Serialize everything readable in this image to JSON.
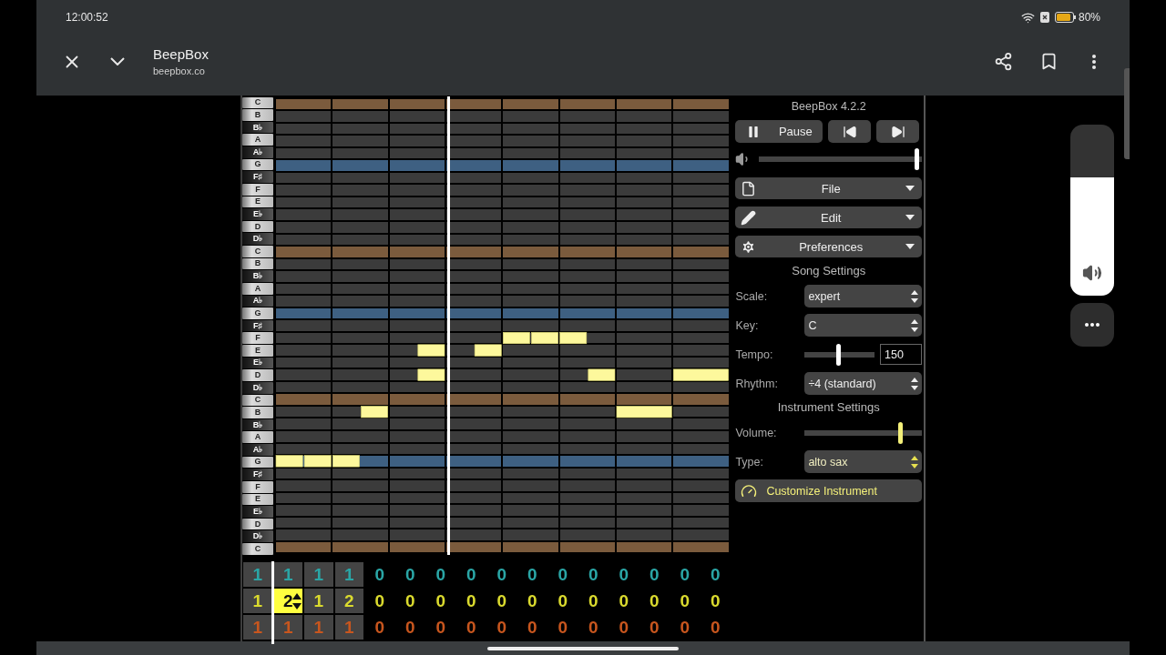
{
  "status_bar": {
    "time": "12:00:52",
    "battery": "80%"
  },
  "browser": {
    "title": "BeepBox",
    "url": "beepbox.co"
  },
  "piano_keys": [
    {
      "label": "C",
      "kind": "white",
      "color": "#7b5b3d"
    },
    {
      "label": "B",
      "kind": "white"
    },
    {
      "label": "B♭",
      "kind": "black"
    },
    {
      "label": "A",
      "kind": "white"
    },
    {
      "label": "A♭",
      "kind": "black"
    },
    {
      "label": "G",
      "kind": "white",
      "color": "#3e6082"
    },
    {
      "label": "F♯",
      "kind": "black"
    },
    {
      "label": "F",
      "kind": "white"
    },
    {
      "label": "E",
      "kind": "white"
    },
    {
      "label": "E♭",
      "kind": "black"
    },
    {
      "label": "D",
      "kind": "white"
    },
    {
      "label": "D♭",
      "kind": "black"
    },
    {
      "label": "C",
      "kind": "white",
      "color": "#7b5b3d"
    },
    {
      "label": "B",
      "kind": "white"
    },
    {
      "label": "B♭",
      "kind": "black"
    },
    {
      "label": "A",
      "kind": "white"
    },
    {
      "label": "A♭",
      "kind": "black"
    },
    {
      "label": "G",
      "kind": "white",
      "color": "#3e6082"
    },
    {
      "label": "F♯",
      "kind": "black"
    },
    {
      "label": "F",
      "kind": "white"
    },
    {
      "label": "E",
      "kind": "white"
    },
    {
      "label": "E♭",
      "kind": "black"
    },
    {
      "label": "D",
      "kind": "white"
    },
    {
      "label": "D♭",
      "kind": "black"
    },
    {
      "label": "C",
      "kind": "white",
      "color": "#7b5b3d"
    },
    {
      "label": "B",
      "kind": "white"
    },
    {
      "label": "B♭",
      "kind": "black"
    },
    {
      "label": "A",
      "kind": "white"
    },
    {
      "label": "A♭",
      "kind": "black"
    },
    {
      "label": "G",
      "kind": "white",
      "color": "#3e6082"
    },
    {
      "label": "F♯",
      "kind": "black"
    },
    {
      "label": "F",
      "kind": "white"
    },
    {
      "label": "E",
      "kind": "white"
    },
    {
      "label": "E♭",
      "kind": "black"
    },
    {
      "label": "D",
      "kind": "white"
    },
    {
      "label": "D♭",
      "kind": "black"
    },
    {
      "label": "C",
      "kind": "white",
      "color": "#7b5b3d"
    }
  ],
  "panel": {
    "version": "BeepBox 4.2.2",
    "pause_label": "Pause",
    "volume": {
      "level": 0.98
    },
    "menus": [
      {
        "label": "File",
        "kind": "file"
      },
      {
        "label": "Edit",
        "kind": "edit"
      },
      {
        "label": "Preferences",
        "kind": "preferences"
      }
    ],
    "song_settings": {
      "heading": "Song Settings",
      "scale": {
        "label": "Scale:",
        "value": "expert"
      },
      "key": {
        "label": "Key:",
        "value": "C"
      },
      "tempo": {
        "label": "Tempo:",
        "level": 0.49,
        "value": "150"
      },
      "rhythm": {
        "label": "Rhythm:",
        "value": "÷4 (standard)"
      }
    },
    "instrument_settings": {
      "heading": "Instrument Settings",
      "volume": {
        "label": "Volume:",
        "level": 0.83
      },
      "type": {
        "label": "Type:",
        "value": "alto sax"
      },
      "customize_label": "Customize Instrument"
    }
  },
  "channels": [
    {
      "color": "#2aa6a6",
      "patterns": [
        {
          "text": "1",
          "selected": false,
          "in_loop": true
        },
        {
          "text": "1",
          "selected": false,
          "in_loop": true
        },
        {
          "text": "1",
          "selected": false,
          "in_loop": true
        },
        {
          "text": "1",
          "selected": false,
          "in_loop": true
        },
        {
          "text": "0",
          "selected": false,
          "in_loop": false
        },
        {
          "text": "0",
          "selected": false,
          "in_loop": false
        },
        {
          "text": "0",
          "selected": false,
          "in_loop": false
        },
        {
          "text": "0",
          "selected": false,
          "in_loop": false
        },
        {
          "text": "0",
          "selected": false,
          "in_loop": false
        },
        {
          "text": "0",
          "selected": false,
          "in_loop": false
        },
        {
          "text": "0",
          "selected": false,
          "in_loop": false
        },
        {
          "text": "0",
          "selected": false,
          "in_loop": false
        },
        {
          "text": "0",
          "selected": false,
          "in_loop": false
        },
        {
          "text": "0",
          "selected": false,
          "in_loop": false
        },
        {
          "text": "0",
          "selected": false,
          "in_loop": false
        },
        {
          "text": "0",
          "selected": false,
          "in_loop": false
        }
      ]
    },
    {
      "color": "#dada2e",
      "patterns": [
        {
          "text": "1",
          "selected": false,
          "in_loop": true
        },
        {
          "text": "2",
          "selected": true,
          "in_loop": true
        },
        {
          "text": "1",
          "selected": false,
          "in_loop": true
        },
        {
          "text": "2",
          "selected": false,
          "in_loop": true
        },
        {
          "text": "0",
          "selected": false,
          "in_loop": false
        },
        {
          "text": "0",
          "selected": false,
          "in_loop": false
        },
        {
          "text": "0",
          "selected": false,
          "in_loop": false
        },
        {
          "text": "0",
          "selected": false,
          "in_loop": false
        },
        {
          "text": "0",
          "selected": false,
          "in_loop": false
        },
        {
          "text": "0",
          "selected": false,
          "in_loop": false
        },
        {
          "text": "0",
          "selected": false,
          "in_loop": false
        },
        {
          "text": "0",
          "selected": false,
          "in_loop": false
        },
        {
          "text": "0",
          "selected": false,
          "in_loop": false
        },
        {
          "text": "0",
          "selected": false,
          "in_loop": false
        },
        {
          "text": "0",
          "selected": false,
          "in_loop": false
        },
        {
          "text": "0",
          "selected": false,
          "in_loop": false
        }
      ]
    },
    {
      "color": "#c8561e",
      "patterns": [
        {
          "text": "1",
          "selected": false,
          "in_loop": true
        },
        {
          "text": "1",
          "selected": false,
          "in_loop": true
        },
        {
          "text": "1",
          "selected": false,
          "in_loop": true
        },
        {
          "text": "1",
          "selected": false,
          "in_loop": true
        },
        {
          "text": "0",
          "selected": false,
          "in_loop": false
        },
        {
          "text": "0",
          "selected": false,
          "in_loop": false
        },
        {
          "text": "0",
          "selected": false,
          "in_loop": false
        },
        {
          "text": "0",
          "selected": false,
          "in_loop": false
        },
        {
          "text": "0",
          "selected": false,
          "in_loop": false
        },
        {
          "text": "0",
          "selected": false,
          "in_loop": false
        },
        {
          "text": "0",
          "selected": false,
          "in_loop": false
        },
        {
          "text": "0",
          "selected": false,
          "in_loop": false
        },
        {
          "text": "0",
          "selected": false,
          "in_loop": false
        },
        {
          "text": "0",
          "selected": false,
          "in_loop": false
        },
        {
          "text": "0",
          "selected": false,
          "in_loop": false
        },
        {
          "text": "0",
          "selected": false,
          "in_loop": false
        }
      ]
    }
  ],
  "system_volume": {
    "level": 0.69
  }
}
